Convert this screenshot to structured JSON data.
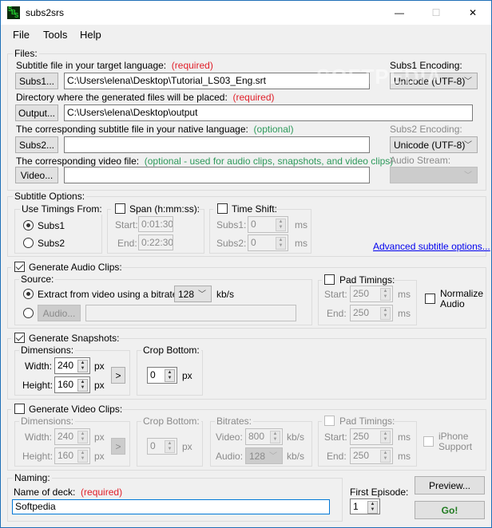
{
  "window": {
    "title": "subs2srs",
    "minimize": "—",
    "maximize": "☐",
    "close": "✕"
  },
  "menu": [
    "File",
    "Tools",
    "Help"
  ],
  "files": {
    "legend": "Files:",
    "subs1_label": "Subtitle file in your target language:",
    "subs1_req": "(required)",
    "subs1_button": "Subs1...",
    "subs1_value": "C:\\Users\\elena\\Desktop\\Tutorial_LS03_Eng.srt",
    "subs1_enc_label": "Subs1 Encoding:",
    "subs1_enc_value": "Unicode (UTF-8)",
    "output_label": "Directory where the generated files will be placed:",
    "output_req": "(required)",
    "output_button": "Output...",
    "output_value": "C:\\Users\\elena\\Desktop\\output",
    "subs2_label": "The corresponding subtitle file in your native language:",
    "subs2_opt": "(optional)",
    "subs2_button": "Subs2...",
    "subs2_value": "",
    "subs2_enc_label": "Subs2 Encoding:",
    "subs2_enc_value": "Unicode (UTF-8)",
    "video_label": "The corresponding video file:",
    "video_opt": "(optional - used for audio clips, snapshots, and video clips)",
    "video_button": "Video...",
    "video_value": "",
    "audio_stream_label": "Audio Stream:",
    "audio_stream_value": ""
  },
  "subtitle_options": {
    "legend": "Subtitle Options:",
    "timings_legend": "Use Timings From:",
    "subs1": "Subs1",
    "subs2": "Subs2",
    "selected": "Subs1",
    "span_legend": "Span (h:mm:ss):",
    "span_checked": false,
    "start_label": "Start:",
    "start_value": "0:01:30",
    "end_label": "End:",
    "end_value": "0:22:30",
    "shift_legend": "Time Shift:",
    "shift_checked": false,
    "shift_subs1_label": "Subs1:",
    "shift_subs1_value": "0",
    "shift_subs2_label": "Subs2:",
    "shift_subs2_value": "0",
    "unit": "ms",
    "advanced_link": "Advanced subtitle options..."
  },
  "audio": {
    "legend": "Generate Audio Clips:",
    "checked": true,
    "source_legend": "Source:",
    "extract_label": "Extract from video using a bitrate of",
    "bitrate": "128",
    "bitrate_unit": "kb/s",
    "audio_button": "Audio...",
    "audio_value": "",
    "pad_legend": "Pad Timings:",
    "pad_checked": false,
    "start_label": "Start:",
    "start_value": "250",
    "end_label": "End:",
    "end_value": "250",
    "unit": "ms",
    "normalize_label": "Normalize Audio",
    "normalize_checked": false
  },
  "snapshots": {
    "legend": "Generate Snapshots:",
    "checked": true,
    "dim_legend": "Dimensions:",
    "width_label": "Width:",
    "width_value": "240",
    "height_label": "Height:",
    "height_value": "160",
    "unit": "px",
    "arrow_button": ">",
    "crop_legend": "Crop Bottom:",
    "crop_value": "0",
    "crop_unit": "px"
  },
  "video": {
    "legend": "Generate Video Clips:",
    "checked": false,
    "dim_legend": "Dimensions:",
    "width_label": "Width:",
    "width_value": "240",
    "height_label": "Height:",
    "height_value": "160",
    "unit": "px",
    "arrow_button": ">",
    "crop_legend": "Crop Bottom:",
    "crop_value": "0",
    "crop_unit": "px",
    "bitrates_legend": "Bitrates:",
    "video_label": "Video:",
    "video_value": "800",
    "audio_label": "Audio:",
    "audio_value": "128",
    "kbs": "kb/s",
    "pad_legend": "Pad Timings:",
    "pad_checked": false,
    "start_label": "Start:",
    "start_value": "250",
    "end_label": "End:",
    "end_value": "250",
    "ms": "ms",
    "iphone_label": "iPhone Support",
    "iphone_checked": false
  },
  "naming": {
    "legend": "Naming:",
    "deck_label": "Name of deck:",
    "deck_req": "(required)",
    "deck_value": "Softpedia",
    "episode_label": "First Episode:",
    "episode_value": "1"
  },
  "actions": {
    "preview": "Preview...",
    "go": "Go!"
  },
  "watermark": "SOFTPEDIA"
}
